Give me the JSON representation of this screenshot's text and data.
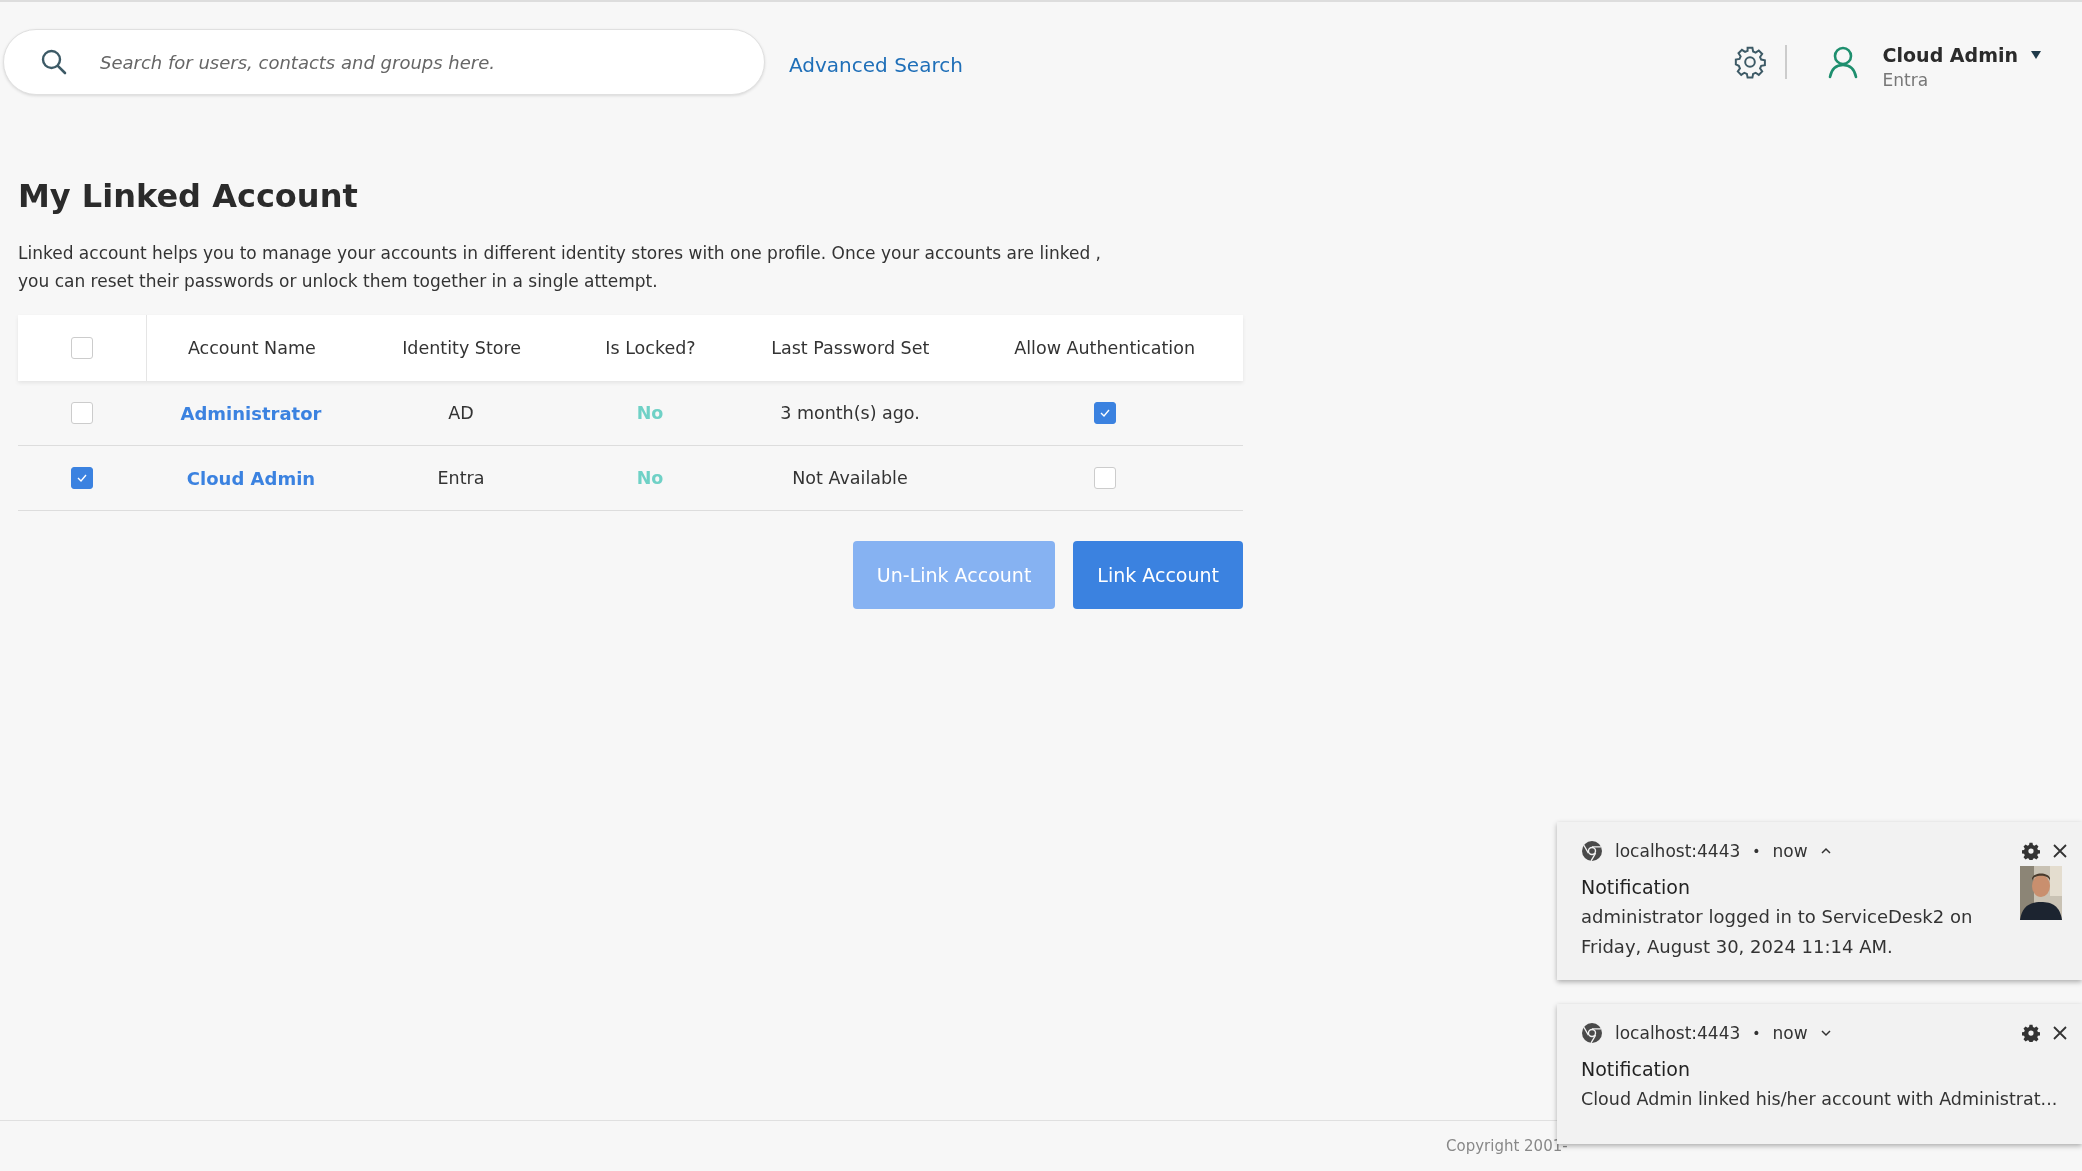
{
  "search": {
    "placeholder": "Search for users, contacts and groups here."
  },
  "advanced_search": "Advanced Search",
  "user": {
    "name": "Cloud Admin",
    "store": "Entra"
  },
  "page": {
    "title": "My Linked Account",
    "description": "Linked account helps you to manage your accounts in different identity stores with one profile. Once your accounts are linked , you can reset their passwords or unlock them together in a single attempt."
  },
  "table": {
    "select_all": {
      "checked": false
    },
    "columns": [
      "Account Name",
      "Identity Store",
      "Is Locked?",
      "Last Password Set",
      "Allow Authentication"
    ],
    "rows": [
      {
        "selected": false,
        "account_name": "Administrator",
        "identity_store": "AD",
        "is_locked": "No",
        "last_password_set": "3 month(s) ago.",
        "allow_authentication": true
      },
      {
        "selected": true,
        "account_name": "Cloud Admin",
        "identity_store": "Entra",
        "is_locked": "No",
        "last_password_set": "Not Available",
        "allow_authentication": false
      }
    ]
  },
  "buttons": [
    {
      "label": "Un-Link Account",
      "disabled": true
    },
    {
      "label": "Link Account",
      "disabled": false
    }
  ],
  "footer": {
    "copyright": "Copyright 2001-"
  },
  "notifications": [
    {
      "source": "localhost:4443",
      "separator": "•",
      "time": "now",
      "expanded": true,
      "title": "Notification",
      "message": "administrator logged in to ServiceDesk2 on Friday, August 30, 2024 11:14 AM."
    },
    {
      "source": "localhost:4443",
      "separator": "•",
      "time": "now",
      "expanded": false,
      "title": "Notification",
      "message": "Cloud Admin linked his/her account with Administrat..."
    }
  ]
}
